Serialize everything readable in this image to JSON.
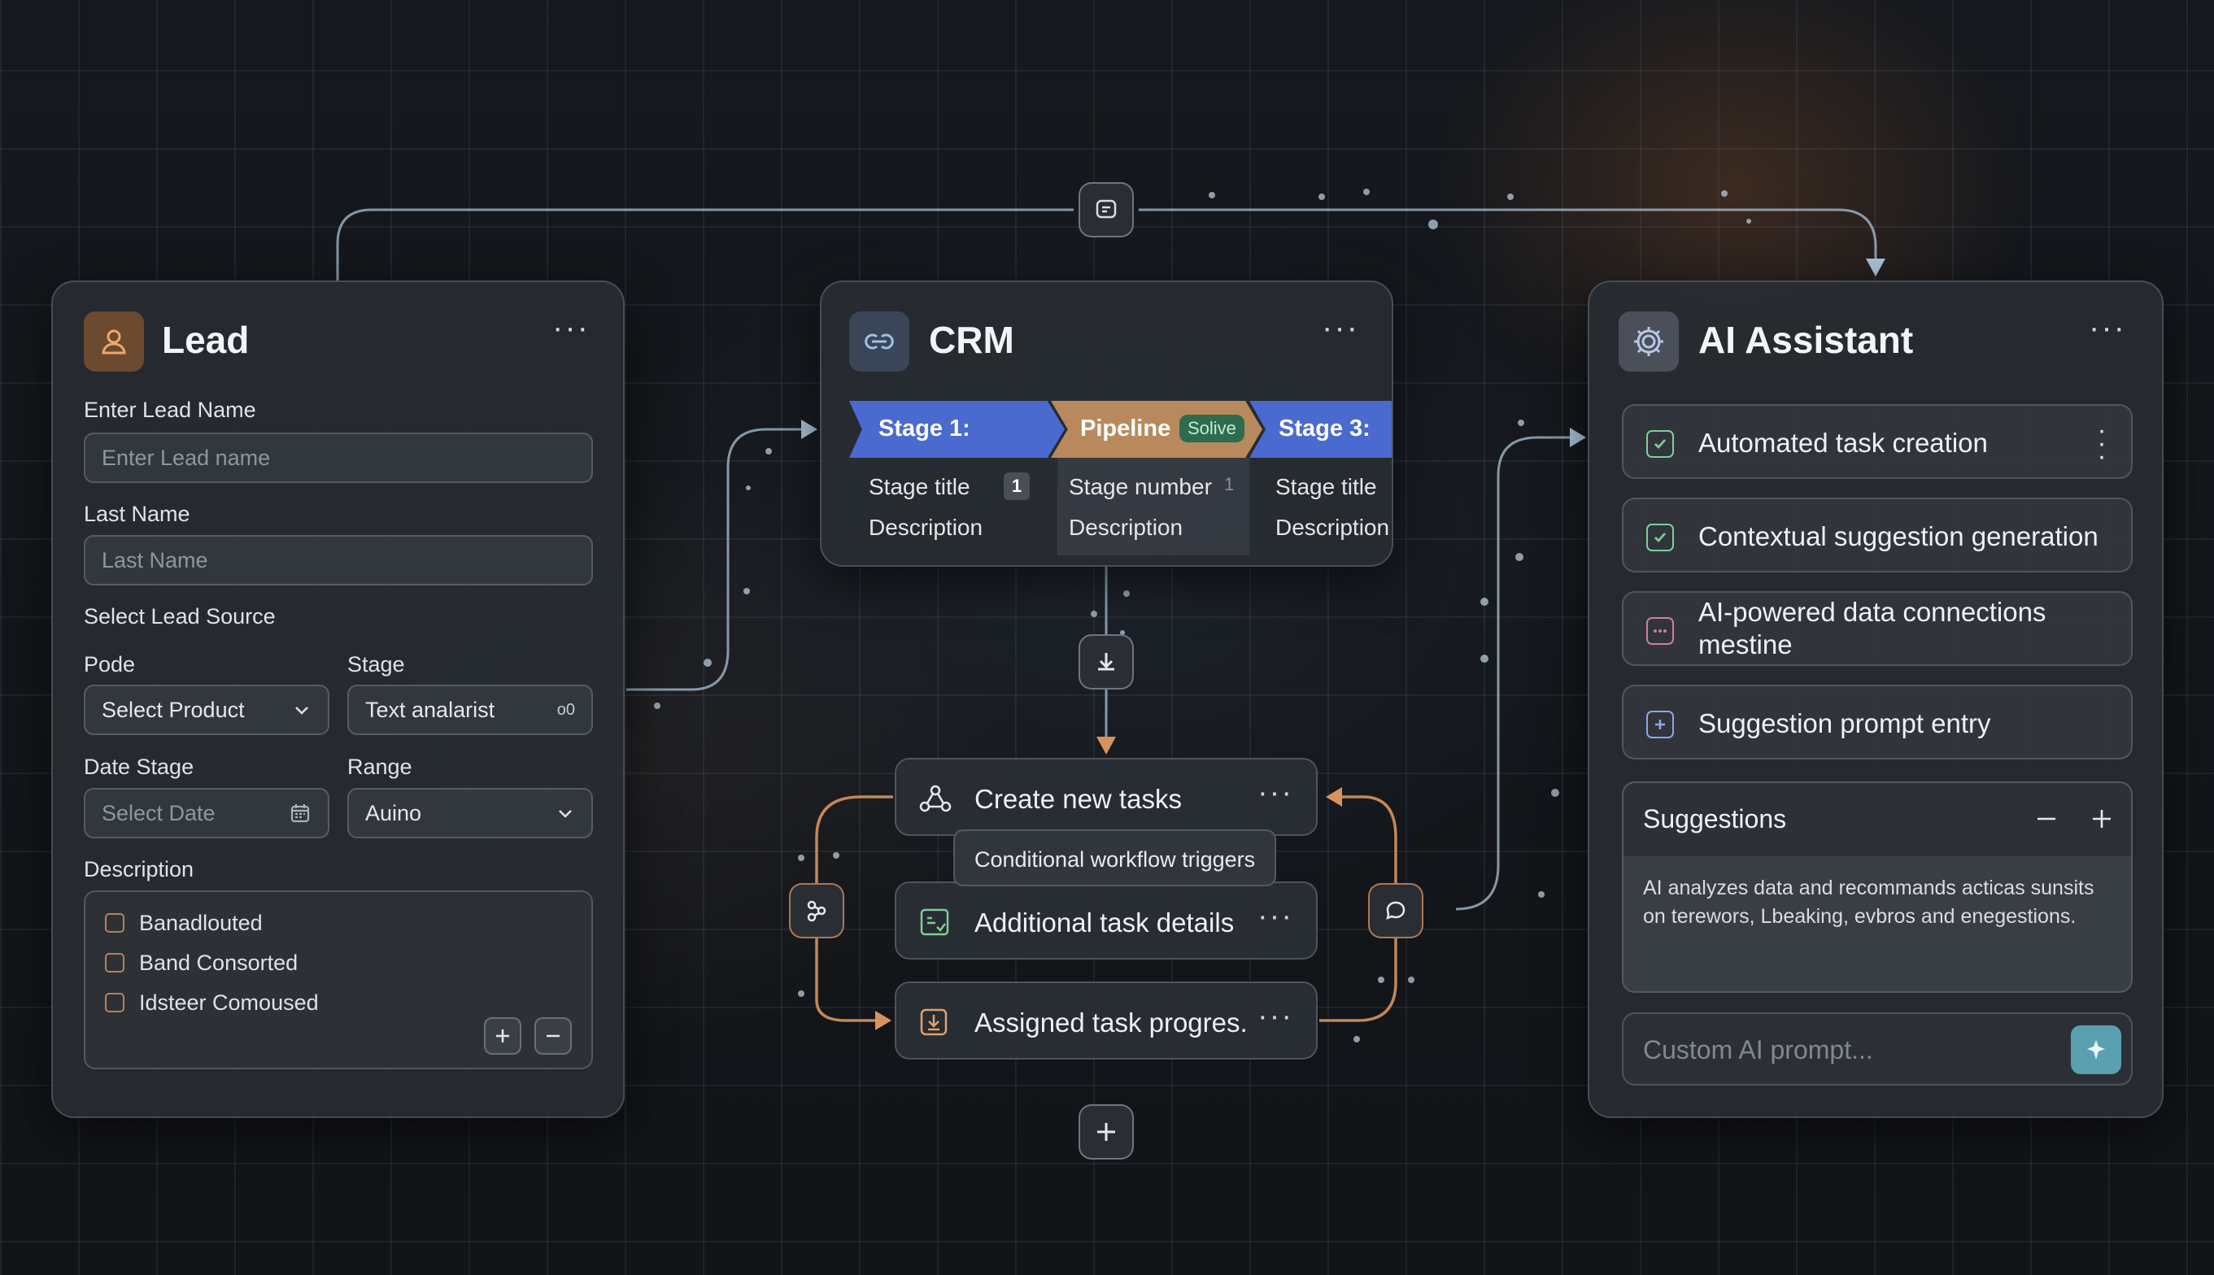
{
  "lead": {
    "title": "Lead",
    "name_label": "Enter Lead Name",
    "name_placeholder": "Enter Lead name",
    "last_label": "Last Name",
    "last_placeholder": "Last Name",
    "source_label": "Select Lead Source",
    "pode_label": "Pode",
    "pode_value": "Select Product",
    "stage_label": "Stage",
    "stage_value": "Text analarist",
    "stage_suffix": "o0",
    "date_label": "Date Stage",
    "date_placeholder": "Select Date",
    "range_label": "Range",
    "range_value": "Auino",
    "desc_label": "Description",
    "checks": [
      "Banadlouted",
      "Band Consorted",
      "Idsteer Comoused"
    ]
  },
  "crm": {
    "title": "CRM",
    "stages": [
      {
        "label": "Stage 1:",
        "color": "#4a6ad0"
      },
      {
        "label": "Pipeline",
        "badge": "Solive",
        "color": "#b8895c"
      },
      {
        "label": "Stage 3:",
        "color": "#4a6ad0"
      }
    ],
    "col1": {
      "title": "Stage title",
      "badge": "1",
      "desc": "Description"
    },
    "col2": {
      "title": "Stage number",
      "badge": "1",
      "desc": "Description"
    },
    "col3": {
      "title": "Stage title",
      "desc": "Description"
    }
  },
  "tasks": {
    "items": [
      {
        "label": "Create new tasks"
      },
      {
        "label": "Additional task details"
      },
      {
        "label": "Assigned task progres."
      }
    ],
    "tooltip": "Conditional workflow triggers"
  },
  "ai": {
    "title": "AI Assistant",
    "items": [
      {
        "label": "Automated task creation"
      },
      {
        "label": "Contextual suggestion generation"
      },
      {
        "label": "AI-powered data connections mestine"
      },
      {
        "label": "Suggestion prompt entry"
      }
    ],
    "suggestions_title": "Suggestions",
    "suggestions_text": "AI analyzes data and recommands acticas sunsits on terewors, Lbeaking, evbros and enegestions.",
    "prompt_placeholder": "Custom AI prompt..."
  },
  "colors": {
    "accent_orange": "#d7935e",
    "accent_blue": "#4a6ad0",
    "accent_teal": "#5aa0b0",
    "connector": "#a9c2d6"
  }
}
